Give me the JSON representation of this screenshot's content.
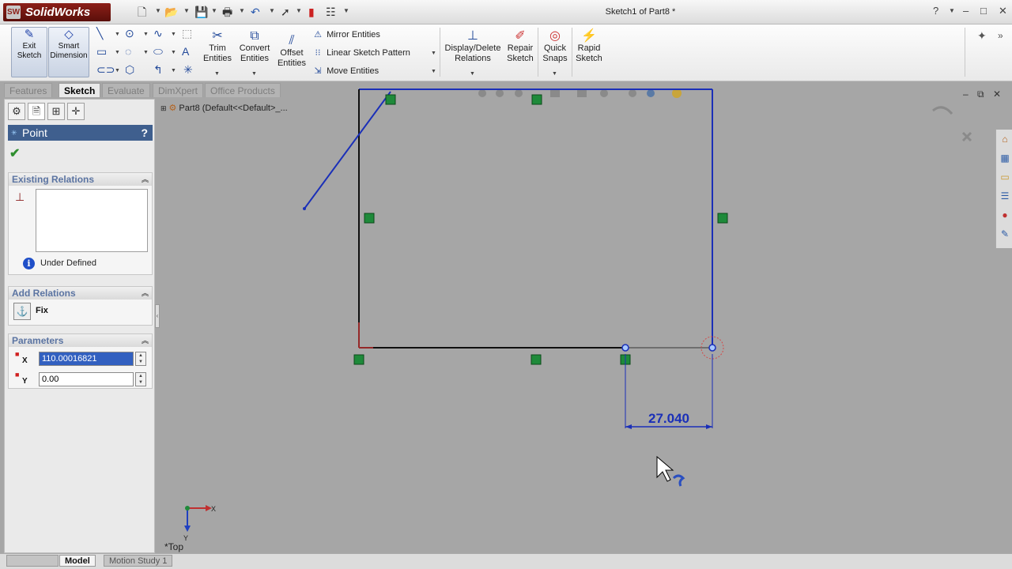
{
  "app": {
    "logo_text": "SolidWorks",
    "logo_mark": "SW",
    "document_title": "Sketch1 of Part8 *"
  },
  "window_controls": {
    "help": "?",
    "minimize": "–",
    "maximize": "□",
    "close": "✕"
  },
  "command_manager": {
    "exit_sketch": "Exit Sketch",
    "smart_dimension": "Smart Dimension",
    "trim_entities": "Trim Entities",
    "convert_entities": "Convert Entities",
    "offset_entities": "Offset Entities",
    "mirror_entities": "Mirror Entities",
    "linear_sketch_pattern": "Linear Sketch Pattern",
    "move_entities": "Move Entities",
    "display_delete_relations": "Display/Delete Relations",
    "repair_sketch": "Repair Sketch",
    "quick_snaps": "Quick Snaps",
    "rapid_sketch": "Rapid Sketch"
  },
  "tabs": [
    {
      "label": "Features",
      "active": false
    },
    {
      "label": "Sketch",
      "active": true
    },
    {
      "label": "Evaluate",
      "active": false
    },
    {
      "label": "DimXpert",
      "active": false
    },
    {
      "label": "Office Products",
      "active": false
    }
  ],
  "property_manager": {
    "title": "Point",
    "help": "?",
    "existing_relations": {
      "header": "Existing Relations",
      "status": "Under Defined"
    },
    "add_relations": {
      "header": "Add Relations",
      "fix_label": "Fix"
    },
    "parameters": {
      "header": "Parameters",
      "x_label": "X",
      "x_value": "110.00016821",
      "y_label": "Y",
      "y_value": "0.00"
    }
  },
  "feature_tree": {
    "item": "Part8  (Default<<Default>_..."
  },
  "graphics": {
    "dimension_value": "27.040",
    "view_orientation": "*Top",
    "triad_x": "X",
    "triad_y": "Y"
  },
  "bottom_tabs": [
    {
      "label": "Model",
      "active": true
    },
    {
      "label": "Motion Study 1",
      "active": false
    }
  ],
  "colors": {
    "sketch_blue": "#1a2fb8",
    "sketch_black": "#101010",
    "relation_green": "#1e8a3a",
    "panel_header": "#3f5f8e",
    "viewport_bg": "#a6a6a6"
  }
}
